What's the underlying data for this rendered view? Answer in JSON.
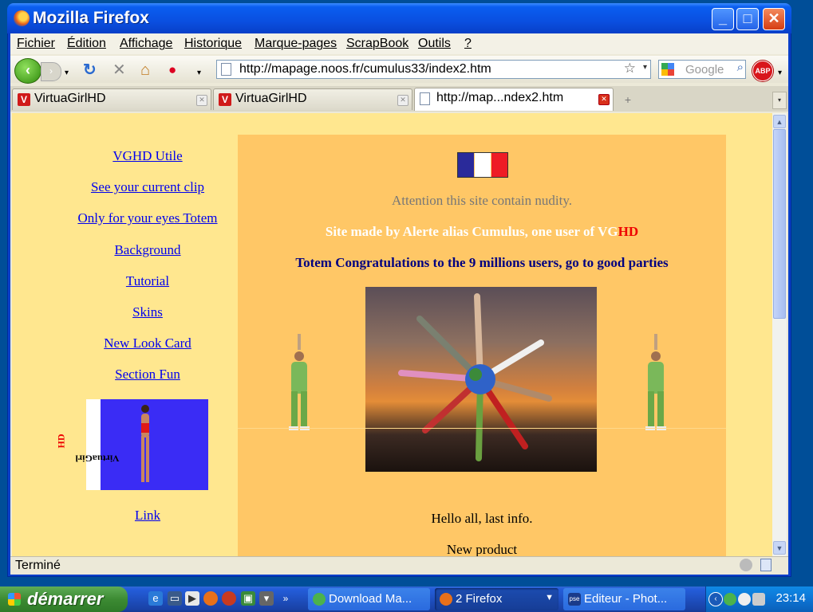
{
  "window": {
    "title": "Mozilla Firefox"
  },
  "menu": [
    "Fichier",
    "Édition",
    "Affichage",
    "Historique",
    "Marque-pages",
    "ScrapBook",
    "Outils",
    "?"
  ],
  "nav": {
    "url": "http://mapage.noos.fr/cumulus33/index2.htm",
    "search_placeholder": "Google",
    "abp_label": "ABP"
  },
  "tabs": [
    {
      "title": "VirtuaGirlHD",
      "icon": "virtuagirl-icon",
      "active": false
    },
    {
      "title": "VirtuaGirlHD",
      "icon": "virtuagirl-icon",
      "active": false
    },
    {
      "title": "http://map...ndex2.htm",
      "icon": "page-icon",
      "active": true
    }
  ],
  "status": {
    "text": "Terminé"
  },
  "page": {
    "links": [
      "VGHD Utile",
      "See your current clip",
      "Only for your eyes Totem",
      "Background",
      "Tutorial",
      "Skins",
      "New Look Card",
      "Section Fun",
      "Link"
    ],
    "banner_text": {
      "prefix": "VirtuaGirl",
      "suffix": "HD"
    },
    "notice": "Attention this site contain nudity.",
    "site_made": {
      "prefix": "Site made by Alerte alias Cumulus, one user of VG",
      "suffix": "HD"
    },
    "totem": "Totem Congratulations to the 9 millions users, go to good parties",
    "hello": "Hello all, last info.",
    "new_product": "New product",
    "colors": {
      "page_bg": "#ffe78f",
      "panel_bg": "#ffc766",
      "link": "#0000ee",
      "accent_red": "#e00000",
      "navy": "#000080"
    }
  },
  "taskbar": {
    "start_label": "démarrer",
    "tasks": [
      {
        "label": "Download Ma...",
        "active": false
      },
      {
        "label": "2 Firefox",
        "active": true
      },
      {
        "label": "Editeur - Phot...",
        "active": false
      }
    ],
    "clock": "23:14"
  }
}
